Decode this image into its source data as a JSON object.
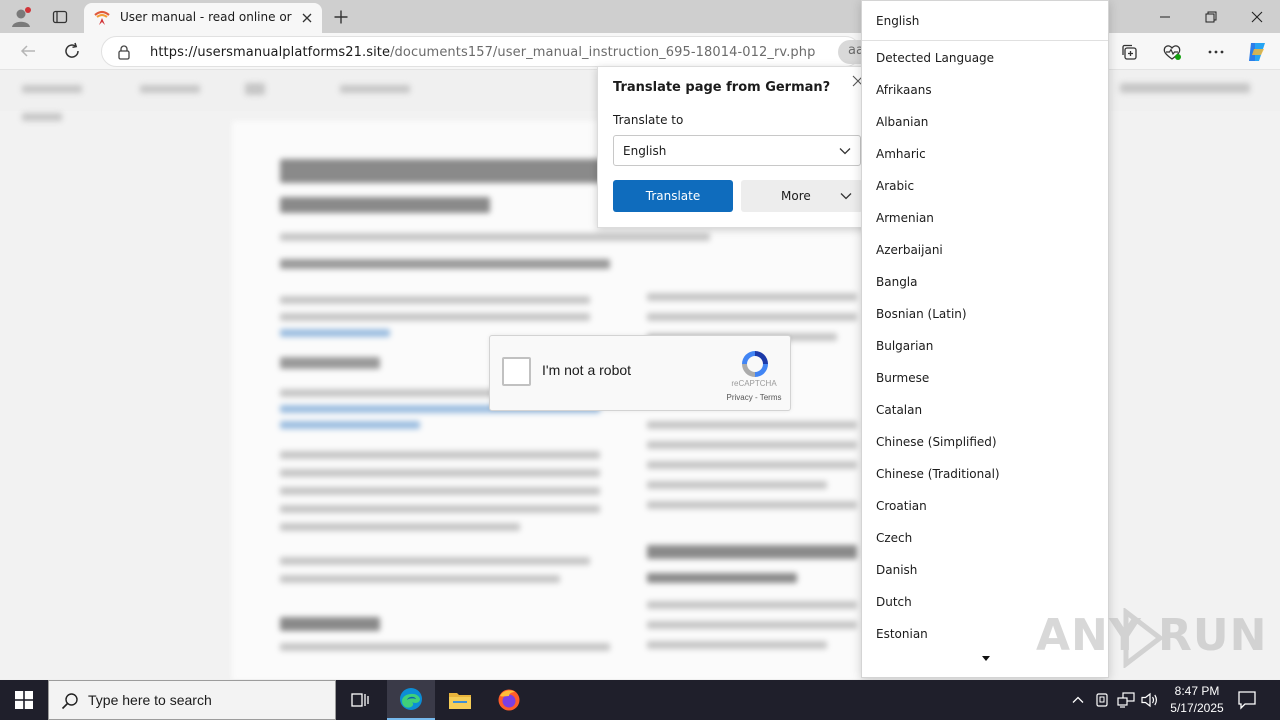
{
  "browser": {
    "tab_title": "User manual - read online or download",
    "url_host": "https://usersmanualplatforms21.site",
    "url_path": "/documents157/user_manual_instruction_695-18014-012_rv.php",
    "reader_chip": "aa"
  },
  "translate_popup": {
    "title": "Translate page from German?",
    "translate_to_label": "Translate to",
    "selected_language": "English",
    "translate_button": "Translate",
    "more_button": "More"
  },
  "language_dropdown": {
    "selected": "English",
    "items": [
      "Detected Language",
      "Afrikaans",
      "Albanian",
      "Amharic",
      "Arabic",
      "Armenian",
      "Azerbaijani",
      "Bangla",
      "Bosnian (Latin)",
      "Bulgarian",
      "Burmese",
      "Catalan",
      "Chinese (Simplified)",
      "Chinese (Traditional)",
      "Croatian",
      "Czech",
      "Danish",
      "Dutch",
      "Estonian"
    ]
  },
  "captcha": {
    "label": "I'm not a robot",
    "brand": "reCAPTCHA",
    "terms": "Privacy - Terms"
  },
  "watermark": {
    "text_left": "ANY",
    "text_right": "RUN"
  },
  "taskbar": {
    "search_placeholder": "Type here to search",
    "time": "8:47 PM",
    "date": "5/17/2025"
  },
  "colors": {
    "accent": "#0f6cbd",
    "taskbar": "#1f1f2b",
    "tab_strip": "#cfcfcf"
  }
}
